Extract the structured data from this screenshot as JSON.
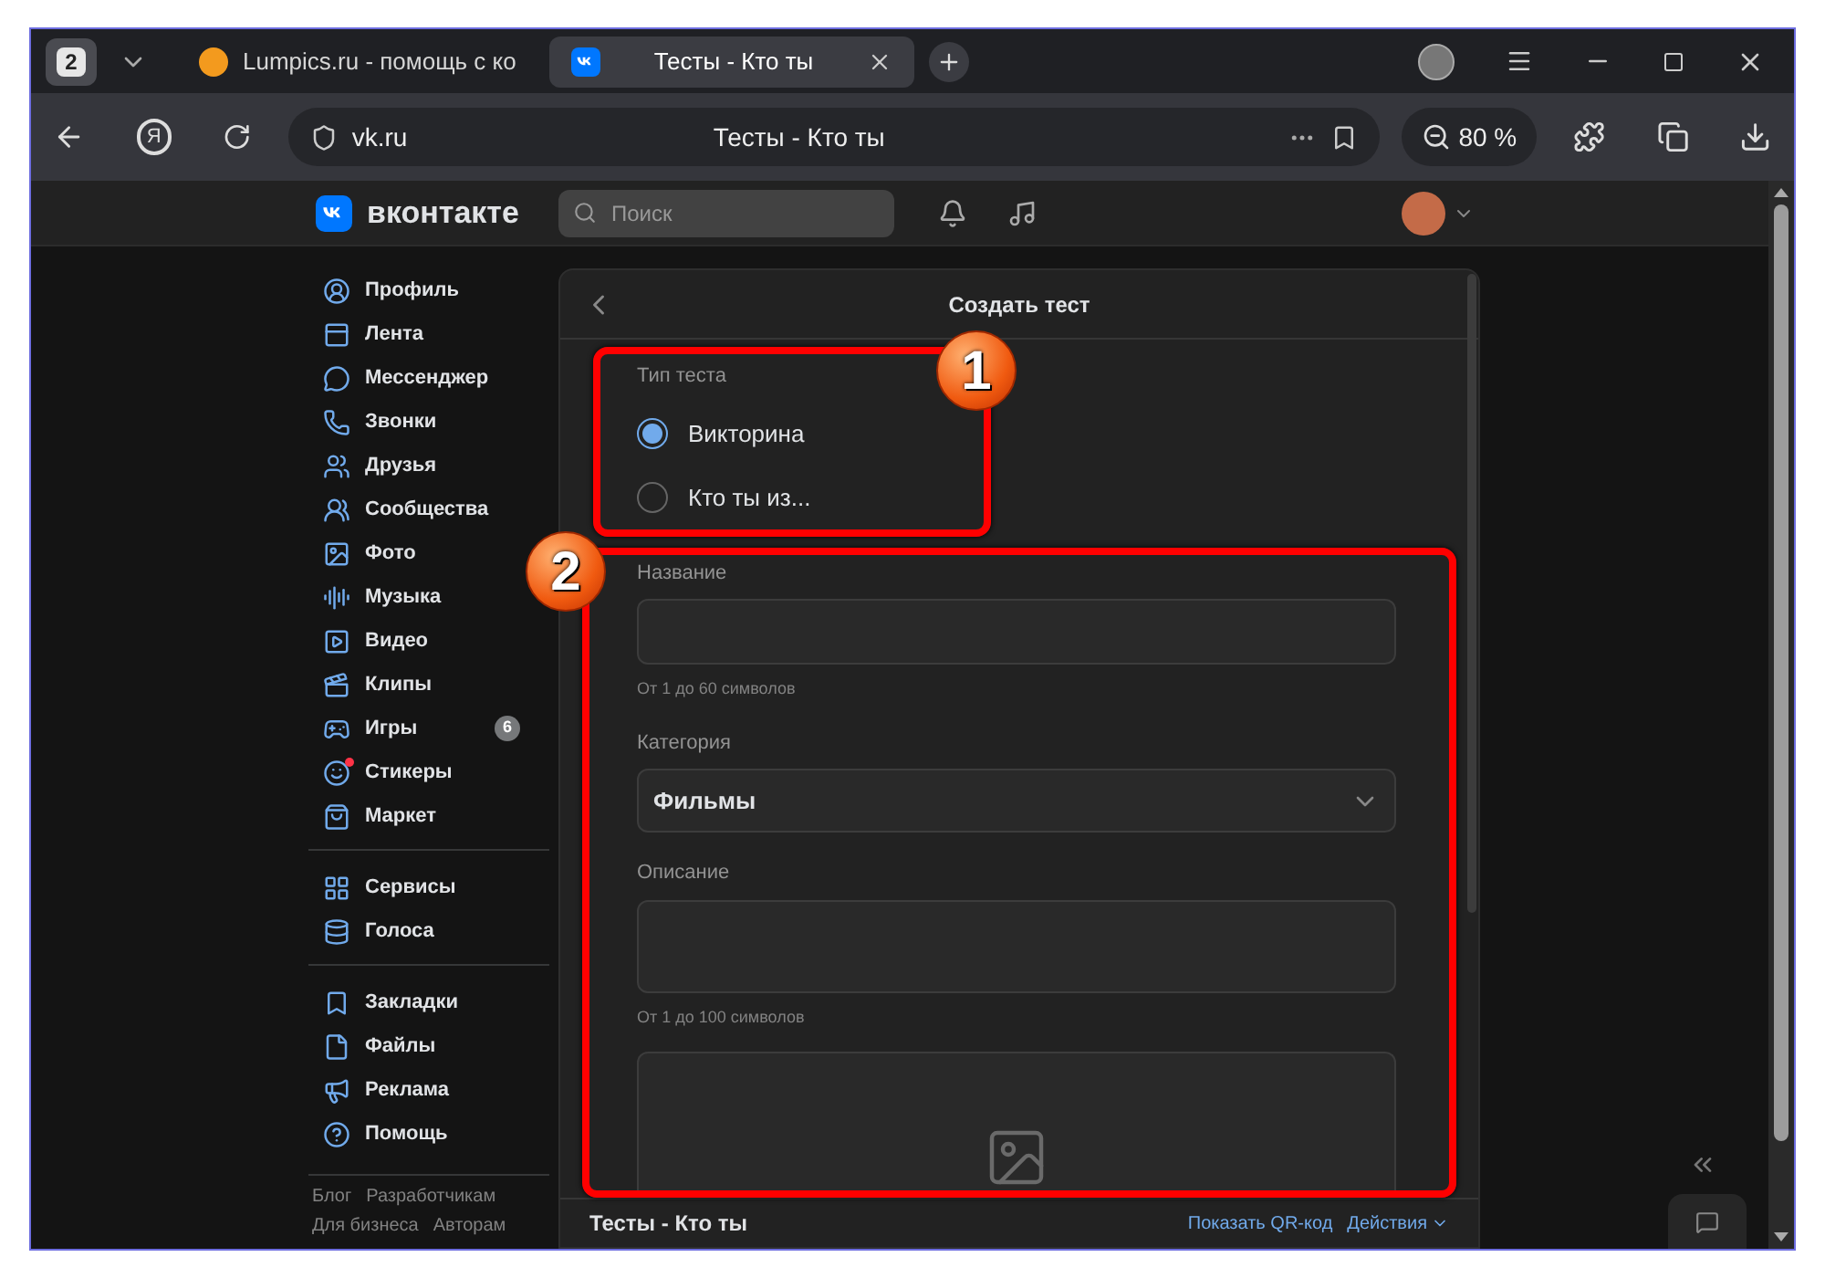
{
  "browser": {
    "tab_count": "2",
    "tabs": [
      {
        "title": "Lumpics.ru - помощь с ко",
        "selected": false
      },
      {
        "title": "Тесты - Кто ты",
        "selected": true
      }
    ],
    "home_glyph": "Я",
    "address": "vk.ru",
    "page_title": "Тесты - Кто ты",
    "zoom": "80 %"
  },
  "header": {
    "logo": "вконтакте",
    "search_placeholder": "Поиск"
  },
  "sidebar": {
    "groups": [
      [
        {
          "label": "Профиль"
        },
        {
          "label": "Лента"
        },
        {
          "label": "Мессенджер"
        },
        {
          "label": "Звонки"
        },
        {
          "label": "Друзья"
        },
        {
          "label": "Сообщества"
        },
        {
          "label": "Фото"
        },
        {
          "label": "Музыка"
        },
        {
          "label": "Видео"
        },
        {
          "label": "Клипы"
        },
        {
          "label": "Игры",
          "badge": "6"
        },
        {
          "label": "Стикеры",
          "dot": true
        },
        {
          "label": "Маркет"
        }
      ],
      [
        {
          "label": "Сервисы"
        },
        {
          "label": "Голоса"
        }
      ],
      [
        {
          "label": "Закладки"
        },
        {
          "label": "Файлы"
        },
        {
          "label": "Реклама"
        },
        {
          "label": "Помощь"
        }
      ]
    ],
    "footer_links": [
      "Блог",
      "Разработчикам",
      "Для бизнеса",
      "Авторам"
    ]
  },
  "form": {
    "title": "Создать тест",
    "type_label": "Тип теста",
    "type_options": [
      {
        "label": "Викторина",
        "selected": true
      },
      {
        "label": "Кто ты из...",
        "selected": false
      }
    ],
    "fields": [
      {
        "kind": "input",
        "label": "Название",
        "hint": "От 1 до 60 символов"
      },
      {
        "kind": "select",
        "label": "Категория",
        "value": "Фильмы"
      },
      {
        "kind": "textarea",
        "label": "Описание",
        "hint": "От 1 до 100 символов"
      },
      {
        "kind": "image"
      }
    ]
  },
  "footer": {
    "title": "Тесты - Кто ты",
    "links": [
      "Показать QR-код",
      "Действия"
    ]
  },
  "annotations": [
    {
      "label": "1"
    },
    {
      "label": "2"
    }
  ]
}
